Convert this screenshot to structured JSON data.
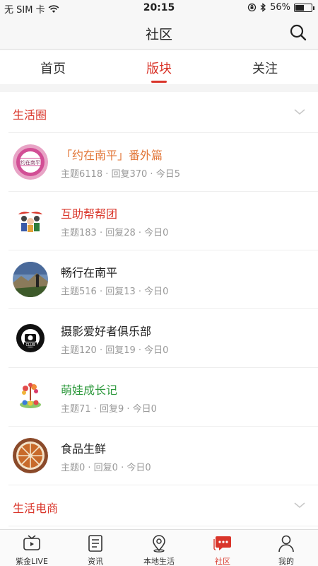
{
  "status_bar": {
    "carrier": "无 SIM 卡",
    "time": "20:15",
    "battery": "56%",
    "battery_level": 0.56
  },
  "nav": {
    "title": "社区",
    "search_icon": "search-icon"
  },
  "tabs": [
    {
      "label": "首页"
    },
    {
      "label": "版块",
      "active": true
    },
    {
      "label": "关注"
    }
  ],
  "sections": [
    {
      "title": "生活圈",
      "expanded": true
    },
    {
      "title": "生活电商",
      "expanded": false
    }
  ],
  "boards": [
    {
      "name": "「约在南平」番外篇",
      "meta": "主题6118 · 回复370 · 今日5",
      "name_color": "#e27638",
      "avatar_text": "约在南平"
    },
    {
      "name": "互助帮帮团",
      "meta": "主题183 · 回复28 · 今日0",
      "name_color": "#d9352a"
    },
    {
      "name": "畅行在南平",
      "meta": "主题516 · 回复13 · 今日0",
      "name_color": "#222222"
    },
    {
      "name": "摄影爱好者俱乐部",
      "meta": "主题120 · 回复19 · 今日0",
      "name_color": "#222222",
      "avatar_text": "CLUB"
    },
    {
      "name": "萌娃成长记",
      "meta": "主题71 · 回复9 · 今日0",
      "name_color": "#2f9a3e"
    },
    {
      "name": "食品生鲜",
      "meta": "主题0 · 回复0 · 今日0",
      "name_color": "#222222"
    }
  ],
  "tabbar": [
    {
      "label": "紫金LIVE",
      "icon": "tv-icon"
    },
    {
      "label": "资讯",
      "icon": "news-icon"
    },
    {
      "label": "本地生活",
      "icon": "location-icon"
    },
    {
      "label": "社区",
      "icon": "chat-icon",
      "active": true
    },
    {
      "label": "我的",
      "icon": "person-icon"
    }
  ],
  "colors": {
    "accent": "#d9352a"
  }
}
